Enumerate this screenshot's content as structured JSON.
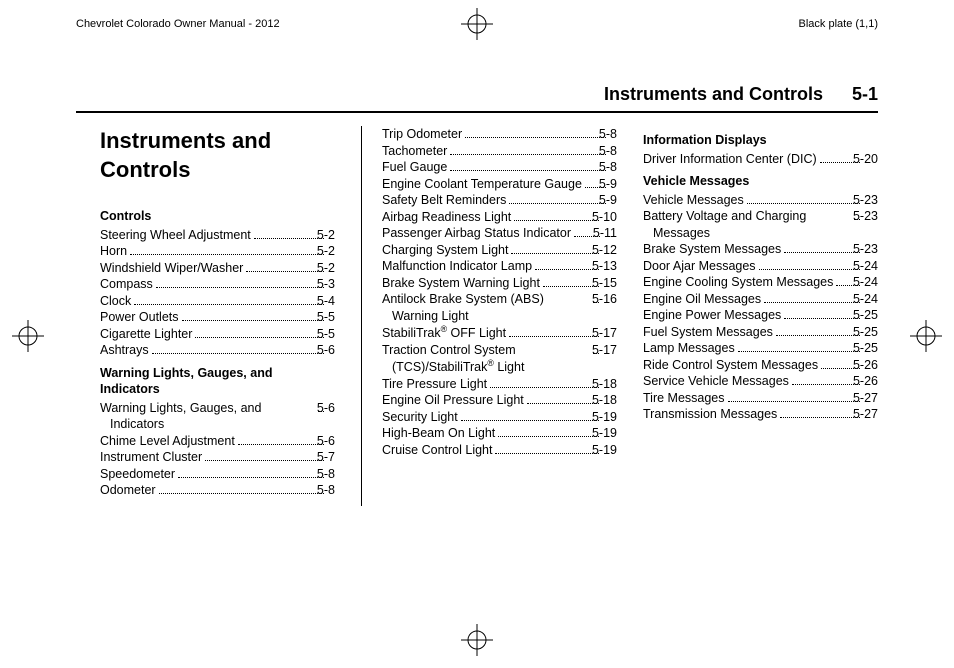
{
  "header": {
    "left": "Chevrolet Colorado Owner Manual - 2012",
    "right": "Black plate (1,1)"
  },
  "running_head": {
    "title": "Instruments and Controls",
    "page": "5-1"
  },
  "page_title": "Instruments and Controls",
  "columns": [
    {
      "groups": [
        {
          "heading": "Controls",
          "items": [
            {
              "label": "Steering Wheel Adjustment",
              "page": "5-2"
            },
            {
              "label": "Horn",
              "page": "5-2"
            },
            {
              "label": "Windshield Wiper/Washer",
              "page": "5-2"
            },
            {
              "label": "Compass",
              "page": "5-3"
            },
            {
              "label": "Clock",
              "page": "5-4"
            },
            {
              "label": "Power Outlets",
              "page": "5-5"
            },
            {
              "label": "Cigarette Lighter",
              "page": "5-5"
            },
            {
              "label": "Ashtrays",
              "page": "5-6"
            }
          ]
        },
        {
          "heading": "Warning Lights, Gauges, and Indicators",
          "items": [
            {
              "label": "Warning Lights, Gauges, and Indicators",
              "page": "5-6"
            },
            {
              "label": "Chime Level Adjustment",
              "page": "5-6"
            },
            {
              "label": "Instrument Cluster",
              "page": "5-7"
            },
            {
              "label": "Speedometer",
              "page": "5-8"
            },
            {
              "label": "Odometer",
              "page": "5-8"
            }
          ]
        }
      ]
    },
    {
      "groups": [
        {
          "heading": "",
          "items": [
            {
              "label": "Trip Odometer",
              "page": "5-8"
            },
            {
              "label": "Tachometer",
              "page": "5-8"
            },
            {
              "label": "Fuel Gauge",
              "page": "5-8"
            },
            {
              "label": "Engine Coolant Temperature Gauge",
              "page": "5-9"
            },
            {
              "label": "Safety Belt Reminders",
              "page": "5-9"
            },
            {
              "label": "Airbag Readiness Light",
              "page": "5-10"
            },
            {
              "label": "Passenger Airbag Status Indicator",
              "page": "5-11"
            },
            {
              "label": "Charging System Light",
              "page": "5-12"
            },
            {
              "label": "Malfunction Indicator Lamp",
              "page": "5-13"
            },
            {
              "label": "Brake System Warning Light",
              "page": "5-15"
            },
            {
              "label": "Antilock Brake System (ABS) Warning Light",
              "page": "5-16"
            },
            {
              "label": "StabiliTrak® OFF Light",
              "page": "5-17"
            },
            {
              "label": "Traction Control System (TCS)/StabiliTrak® Light",
              "page": "5-17"
            },
            {
              "label": "Tire Pressure Light",
              "page": "5-18"
            },
            {
              "label": "Engine Oil Pressure Light",
              "page": "5-18"
            },
            {
              "label": "Security Light",
              "page": "5-19"
            },
            {
              "label": "High-Beam On Light",
              "page": "5-19"
            },
            {
              "label": "Cruise Control Light",
              "page": "5-19"
            }
          ]
        }
      ]
    },
    {
      "groups": [
        {
          "heading": "Information Displays",
          "items": [
            {
              "label": "Driver Information Center (DIC)",
              "page": "5-20"
            }
          ]
        },
        {
          "heading": "Vehicle Messages",
          "items": [
            {
              "label": "Vehicle Messages",
              "page": "5-23"
            },
            {
              "label": "Battery Voltage and Charging Messages",
              "page": "5-23"
            },
            {
              "label": "Brake System Messages",
              "page": "5-23"
            },
            {
              "label": "Door Ajar Messages",
              "page": "5-24"
            },
            {
              "label": "Engine Cooling System Messages",
              "page": "5-24"
            },
            {
              "label": "Engine Oil Messages",
              "page": "5-24"
            },
            {
              "label": "Engine Power Messages",
              "page": "5-25"
            },
            {
              "label": "Fuel System Messages",
              "page": "5-25"
            },
            {
              "label": "Lamp Messages",
              "page": "5-25"
            },
            {
              "label": "Ride Control System Messages",
              "page": "5-26"
            },
            {
              "label": "Service Vehicle Messages",
              "page": "5-26"
            },
            {
              "label": "Tire Messages",
              "page": "5-27"
            },
            {
              "label": "Transmission Messages",
              "page": "5-27"
            }
          ]
        }
      ]
    }
  ]
}
